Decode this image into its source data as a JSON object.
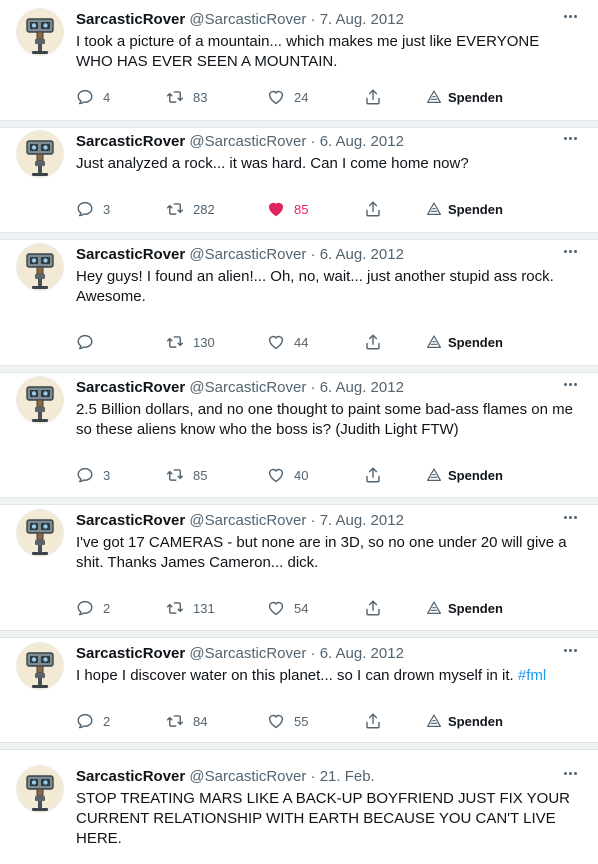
{
  "tweets": [
    {
      "name": "SarcasticRover",
      "handle": "@SarcasticRover",
      "dot": "·",
      "date": "7. Aug. 2012",
      "text": "I took a picture of a mountain... which makes me just like EVERYONE WHO HAS EVER SEEN A MOUNTAIN.",
      "hashtag": "",
      "replies": "4",
      "retweets": "83",
      "likes": "24",
      "liked": false,
      "donate": "Spenden"
    },
    {
      "name": "SarcasticRover",
      "handle": "@SarcasticRover",
      "dot": "·",
      "date": "6. Aug. 2012",
      "text": "Just analyzed a rock... it was hard. Can I come home now?",
      "hashtag": "",
      "replies": "3",
      "retweets": "282",
      "likes": "85",
      "liked": true,
      "donate": "Spenden"
    },
    {
      "name": "SarcasticRover",
      "handle": "@SarcasticRover",
      "dot": "·",
      "date": "6. Aug. 2012",
      "text": "Hey guys! I found an alien!... Oh, no, wait... just another stupid ass rock. Awesome.",
      "hashtag": "",
      "replies": "",
      "retweets": "130",
      "likes": "44",
      "liked": false,
      "donate": "Spenden"
    },
    {
      "name": "SarcasticRover",
      "handle": "@SarcasticRover",
      "dot": "·",
      "date": "6. Aug. 2012",
      "text": "2.5 Billion dollars, and no one thought to paint some bad-ass flames on me so these aliens know who the boss is? (Judith Light FTW)",
      "hashtag": "",
      "replies": "3",
      "retweets": "85",
      "likes": "40",
      "liked": false,
      "donate": "Spenden"
    },
    {
      "name": "SarcasticRover",
      "handle": "@SarcasticRover",
      "dot": "·",
      "date": "7. Aug. 2012",
      "text": "I've got 17 CAMERAS - but none are in 3D, so no one under 20 will give a shit. Thanks James Cameron... dick.",
      "hashtag": "",
      "replies": "2",
      "retweets": "131",
      "likes": "54",
      "liked": false,
      "donate": "Spenden"
    },
    {
      "name": "SarcasticRover",
      "handle": "@SarcasticRover",
      "dot": "·",
      "date": "6. Aug. 2012",
      "text": "I hope I discover water on this planet... so I can drown myself in it. ",
      "hashtag": "#fml",
      "replies": "2",
      "retweets": "84",
      "likes": "55",
      "liked": false,
      "donate": "Spenden"
    },
    {
      "name": "SarcasticRover",
      "handle": "@SarcasticRover",
      "dot": "·",
      "date": "21. Feb.",
      "text": "STOP TREATING MARS LIKE A BACK-UP BOYFRIEND JUST FIX YOUR CURRENT RELATIONSHIP WITH EARTH BECAUSE YOU CAN'T LIVE HERE.",
      "hashtag": "",
      "show_actions": false
    }
  ],
  "icons": {
    "reply": "reply-icon",
    "retweet": "retweet-icon",
    "like": "heart-icon",
    "share": "share-icon",
    "donate": "donate-icon",
    "more": "more-icon"
  },
  "colors": {
    "like_active": "#e0245e",
    "hashtag": "#1d9bf0",
    "muted": "#536471",
    "separator": "#eff3f4"
  }
}
